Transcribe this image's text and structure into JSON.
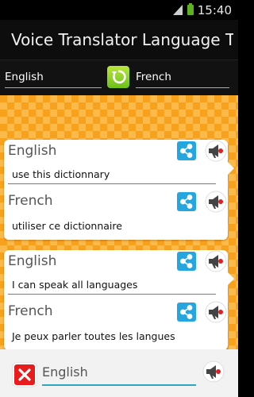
{
  "status_bar": {
    "time": "15:40"
  },
  "app": {
    "title": "Voice Translator Language Tra..."
  },
  "language_bar": {
    "source": "English",
    "target": "French"
  },
  "translations": [
    {
      "source_lang": "English",
      "source_text": "use this dictionnary",
      "target_lang": "French",
      "target_text": "utiliser ce dictionnaire"
    },
    {
      "source_lang": "English",
      "source_text": "I can speak all languages",
      "target_lang": "French",
      "target_text": "Je peux parler toutes les langues"
    }
  ],
  "input": {
    "language": "English"
  },
  "colors": {
    "background_orange": "#f7a11d",
    "share_blue": "#25a6df",
    "accent_teal": "#2aa6c2",
    "clear_red": "#e81c1c",
    "swap_green": "#6cc01a"
  }
}
